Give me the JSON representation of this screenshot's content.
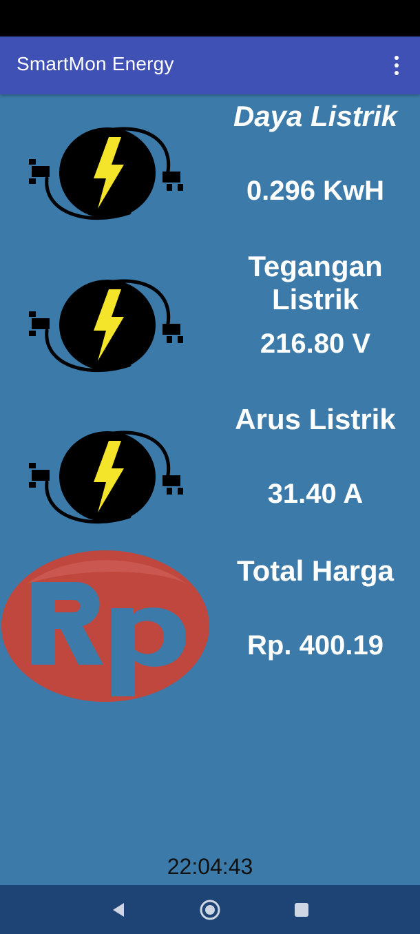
{
  "app_bar": {
    "title": "SmartMon Energy",
    "overflow_icon": "more-vert-icon"
  },
  "metrics": [
    {
      "label": "Daya Listrik",
      "value": "0.296 KwH",
      "icon": "electric-plug-icon"
    },
    {
      "label": "Tegangan Listrik",
      "value": "216.80 V",
      "icon": "electric-plug-icon"
    },
    {
      "label": "Arus Listrik",
      "value": "31.40 A",
      "icon": "electric-plug-icon"
    },
    {
      "label": "Total Harga",
      "value": "Rp. 400.19",
      "icon": "rupiah-icon",
      "icon_text": "Rp"
    }
  ],
  "clock": "22:04:43",
  "nav": {
    "back_icon": "back-icon",
    "home_icon": "home-icon",
    "recents_icon": "recents-icon"
  },
  "colors": {
    "background": "#3b7aa9",
    "app_bar": "#3f51b5",
    "nav_bar": "#1d4474",
    "bolt": "#f5e52a",
    "rupiah_red": "#c0473e"
  }
}
